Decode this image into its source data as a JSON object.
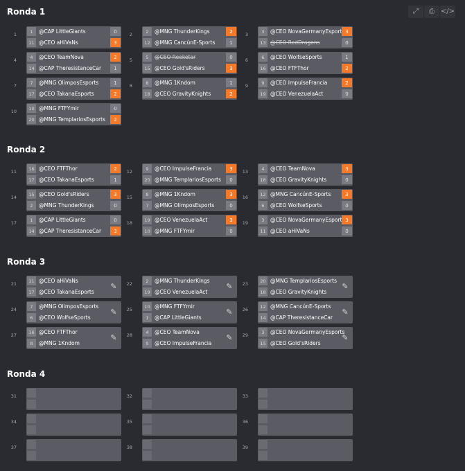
{
  "toolbar": {
    "expand": "⤢",
    "print": "⎙",
    "embed": "</>"
  },
  "rounds": [
    {
      "title": "Ronda 1",
      "matches": [
        {
          "num": "1",
          "teams": [
            {
              "seed": "1",
              "name": "@CAP LittleGiants",
              "score": "0",
              "win": false,
              "dq": false
            },
            {
              "seed": "11",
              "name": "@CEO aHiVaNs",
              "score": "3",
              "win": true,
              "dq": false
            }
          ]
        },
        {
          "num": "2",
          "teams": [
            {
              "seed": "2",
              "name": "@MNG ThunderKings",
              "score": "2",
              "win": true,
              "dq": false
            },
            {
              "seed": "12",
              "name": "@MNG CancúnE-Sports",
              "score": "1",
              "win": false,
              "dq": false
            }
          ]
        },
        {
          "num": "3",
          "teams": [
            {
              "seed": "3",
              "name": "@CEO NovaGermanyEsports",
              "score": "3",
              "win": true,
              "dq": false
            },
            {
              "seed": "13",
              "name": "@CEO RedDragons",
              "score": "0",
              "win": false,
              "dq": true
            }
          ]
        },
        {
          "num": "4",
          "teams": [
            {
              "seed": "4",
              "name": "@CEO TeamNova",
              "score": "2",
              "win": true,
              "dq": false
            },
            {
              "seed": "14",
              "name": "@CAP TheresistanceCar",
              "score": "1",
              "win": false,
              "dq": false
            }
          ]
        },
        {
          "num": "5",
          "teams": [
            {
              "seed": "5",
              "name": "@CEO Reeketar",
              "score": "0",
              "win": false,
              "dq": true
            },
            {
              "seed": "15",
              "name": "@CEO Gold'sRiders",
              "score": "3",
              "win": true,
              "dq": false
            }
          ]
        },
        {
          "num": "6",
          "teams": [
            {
              "seed": "6",
              "name": "@CEO WolfseSports",
              "score": "1",
              "win": false,
              "dq": false
            },
            {
              "seed": "16",
              "name": "@CEO FTFThor",
              "score": "2",
              "win": true,
              "dq": false
            }
          ]
        },
        {
          "num": "7",
          "teams": [
            {
              "seed": "7",
              "name": "@MNG OlimposEsports",
              "score": "1",
              "win": false,
              "dq": false
            },
            {
              "seed": "17",
              "name": "@CEO TakanaEsports",
              "score": "2",
              "win": true,
              "dq": false
            }
          ]
        },
        {
          "num": "8",
          "teams": [
            {
              "seed": "8",
              "name": "@MNG 1Kndom",
              "score": "1",
              "win": false,
              "dq": false
            },
            {
              "seed": "18",
              "name": "@CEO GravityKnights",
              "score": "2",
              "win": true,
              "dq": false
            }
          ]
        },
        {
          "num": "9",
          "teams": [
            {
              "seed": "9",
              "name": "@CEO ImpulseFrancia",
              "score": "2",
              "win": true,
              "dq": false
            },
            {
              "seed": "19",
              "name": "@CEO VenezuelaAct",
              "score": "0",
              "win": false,
              "dq": false
            }
          ]
        },
        {
          "num": "10",
          "teams": [
            {
              "seed": "10",
              "name": "@MNG FTFYmir",
              "score": "0",
              "win": false,
              "dq": false
            },
            {
              "seed": "20",
              "name": "@MNG TemplariosEsports",
              "score": "2",
              "win": true,
              "dq": false
            }
          ]
        }
      ]
    },
    {
      "title": "Ronda 2",
      "matches": [
        {
          "num": "11",
          "teams": [
            {
              "seed": "16",
              "name": "@CEO FTFThor",
              "score": "2",
              "win": true,
              "dq": false
            },
            {
              "seed": "17",
              "name": "@CEO TakanaEsports",
              "score": "1",
              "win": false,
              "dq": false
            }
          ]
        },
        {
          "num": "12",
          "teams": [
            {
              "seed": "9",
              "name": "@CEO ImpulseFrancia",
              "score": "3",
              "win": true,
              "dq": false
            },
            {
              "seed": "20",
              "name": "@MNG TemplariosEsports",
              "score": "0",
              "win": false,
              "dq": false
            }
          ]
        },
        {
          "num": "13",
          "teams": [
            {
              "seed": "4",
              "name": "@CEO TeamNova",
              "score": "3",
              "win": true,
              "dq": false
            },
            {
              "seed": "18",
              "name": "@CEO GravityKnights",
              "score": "0",
              "win": false,
              "dq": false
            }
          ]
        },
        {
          "num": "14",
          "teams": [
            {
              "seed": "15",
              "name": "@CEO Gold'sRiders",
              "score": "3",
              "win": true,
              "dq": false
            },
            {
              "seed": "2",
              "name": "@MNG ThunderKings",
              "score": "0",
              "win": false,
              "dq": false
            }
          ]
        },
        {
          "num": "15",
          "teams": [
            {
              "seed": "8",
              "name": "@MNG 1Kndom",
              "score": "3",
              "win": true,
              "dq": false
            },
            {
              "seed": "7",
              "name": "@MNG OlimposEsports",
              "score": "0",
              "win": false,
              "dq": false
            }
          ]
        },
        {
          "num": "16",
          "teams": [
            {
              "seed": "12",
              "name": "@MNG CancúnE-Sports",
              "score": "3",
              "win": true,
              "dq": false
            },
            {
              "seed": "6",
              "name": "@CEO WolfseSports",
              "score": "0",
              "win": false,
              "dq": false
            }
          ]
        },
        {
          "num": "17",
          "teams": [
            {
              "seed": "1",
              "name": "@CAP LittleGiants",
              "score": "0",
              "win": false,
              "dq": false
            },
            {
              "seed": "14",
              "name": "@CAP TheresistanceCar",
              "score": "3",
              "win": true,
              "dq": false
            }
          ]
        },
        {
          "num": "18",
          "teams": [
            {
              "seed": "19",
              "name": "@CEO VenezuelaAct",
              "score": "3",
              "win": true,
              "dq": false
            },
            {
              "seed": "10",
              "name": "@MNG FTFYmir",
              "score": "0",
              "win": false,
              "dq": false
            }
          ]
        },
        {
          "num": "19",
          "teams": [
            {
              "seed": "3",
              "name": "@CEO NovaGermanyEsports",
              "score": "3",
              "win": true,
              "dq": false
            },
            {
              "seed": "11",
              "name": "@CEO aHiVaNs",
              "score": "0",
              "win": false,
              "dq": false
            }
          ]
        }
      ]
    },
    {
      "title": "Ronda 3",
      "matches": [
        {
          "num": "21",
          "edit": true,
          "teams": [
            {
              "seed": "11",
              "name": "@CEO aHiVaNs",
              "score": "",
              "win": false,
              "dq": false
            },
            {
              "seed": "17",
              "name": "@CEO TakanaEsports",
              "score": "",
              "win": false,
              "dq": false
            }
          ]
        },
        {
          "num": "22",
          "edit": true,
          "teams": [
            {
              "seed": "2",
              "name": "@MNG ThunderKings",
              "score": "",
              "win": false,
              "dq": false
            },
            {
              "seed": "19",
              "name": "@CEO VenezuelaAct",
              "score": "",
              "win": false,
              "dq": false
            }
          ]
        },
        {
          "num": "23",
          "edit": true,
          "teams": [
            {
              "seed": "20",
              "name": "@MNG TemplariosEsports",
              "score": "",
              "win": false,
              "dq": false
            },
            {
              "seed": "18",
              "name": "@CEO GravityKnights",
              "score": "",
              "win": false,
              "dq": false
            }
          ]
        },
        {
          "num": "24",
          "edit": true,
          "teams": [
            {
              "seed": "7",
              "name": "@MNG OlimposEsports",
              "score": "",
              "win": false,
              "dq": false
            },
            {
              "seed": "6",
              "name": "@CEO WolfseSports",
              "score": "",
              "win": false,
              "dq": false
            }
          ]
        },
        {
          "num": "25",
          "edit": true,
          "teams": [
            {
              "seed": "10",
              "name": "@MNG FTFYmir",
              "score": "",
              "win": false,
              "dq": false
            },
            {
              "seed": "1",
              "name": "@CAP LittleGiants",
              "score": "",
              "win": false,
              "dq": false
            }
          ]
        },
        {
          "num": "26",
          "edit": true,
          "teams": [
            {
              "seed": "12",
              "name": "@MNG CancúnE-Sports",
              "score": "",
              "win": false,
              "dq": false
            },
            {
              "seed": "14",
              "name": "@CAP TheresistanceCar",
              "score": "",
              "win": false,
              "dq": false
            }
          ]
        },
        {
          "num": "27",
          "edit": true,
          "teams": [
            {
              "seed": "16",
              "name": "@CEO FTFThor",
              "score": "",
              "win": false,
              "dq": false
            },
            {
              "seed": "8",
              "name": "@MNG 1Kndom",
              "score": "",
              "win": false,
              "dq": false
            }
          ]
        },
        {
          "num": "28",
          "edit": true,
          "teams": [
            {
              "seed": "4",
              "name": "@CEO TeamNova",
              "score": "",
              "win": false,
              "dq": false
            },
            {
              "seed": "9",
              "name": "@CEO ImpulseFrancia",
              "score": "",
              "win": false,
              "dq": false
            }
          ]
        },
        {
          "num": "29",
          "edit": true,
          "teams": [
            {
              "seed": "3",
              "name": "@CEO NovaGermanyEsports",
              "score": "",
              "win": false,
              "dq": false
            },
            {
              "seed": "15",
              "name": "@CEO Gold'sRiders",
              "score": "",
              "win": false,
              "dq": false
            }
          ]
        }
      ]
    },
    {
      "title": "Ronda 4",
      "matches": [
        {
          "num": "31",
          "empty": true
        },
        {
          "num": "32",
          "empty": true
        },
        {
          "num": "33",
          "empty": true
        },
        {
          "num": "34",
          "empty": true
        },
        {
          "num": "35",
          "empty": true
        },
        {
          "num": "36",
          "empty": true
        },
        {
          "num": "37",
          "empty": true
        },
        {
          "num": "38",
          "empty": true
        },
        {
          "num": "39",
          "empty": true
        }
      ]
    }
  ]
}
